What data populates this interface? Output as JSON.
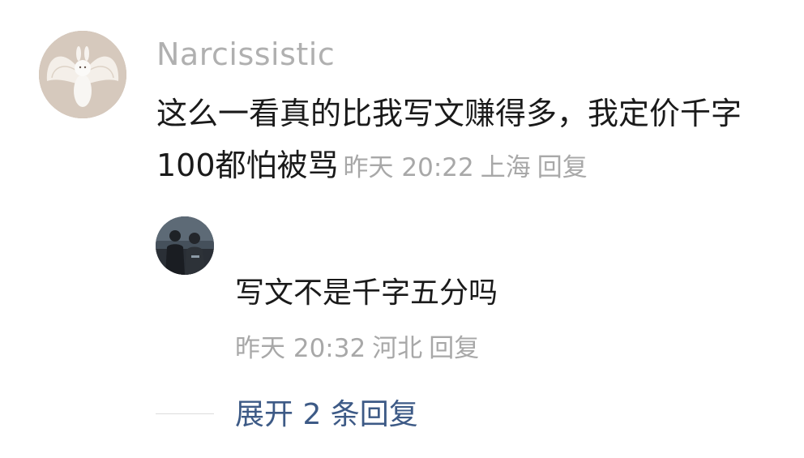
{
  "comment": {
    "username": "Narcissistic",
    "text": "这么一看真的比我写文赚得多，我定价千字100都怕被骂",
    "time": "昨天 20:22",
    "location": "上海",
    "reply_label": "回复",
    "avatar_icon": "white-rabbit-with-wings"
  },
  "reply": {
    "text": "写文不是千字五分吗",
    "time": "昨天 20:32",
    "location": "河北",
    "reply_label": "回复",
    "avatar_icon": "two-people-night-photo"
  },
  "expand": {
    "label": "展开 2 条回复"
  },
  "colors": {
    "username": "#b0b0b0",
    "text": "#1a1a1a",
    "meta": "#a8a8a8",
    "link": "#3d5a86"
  }
}
